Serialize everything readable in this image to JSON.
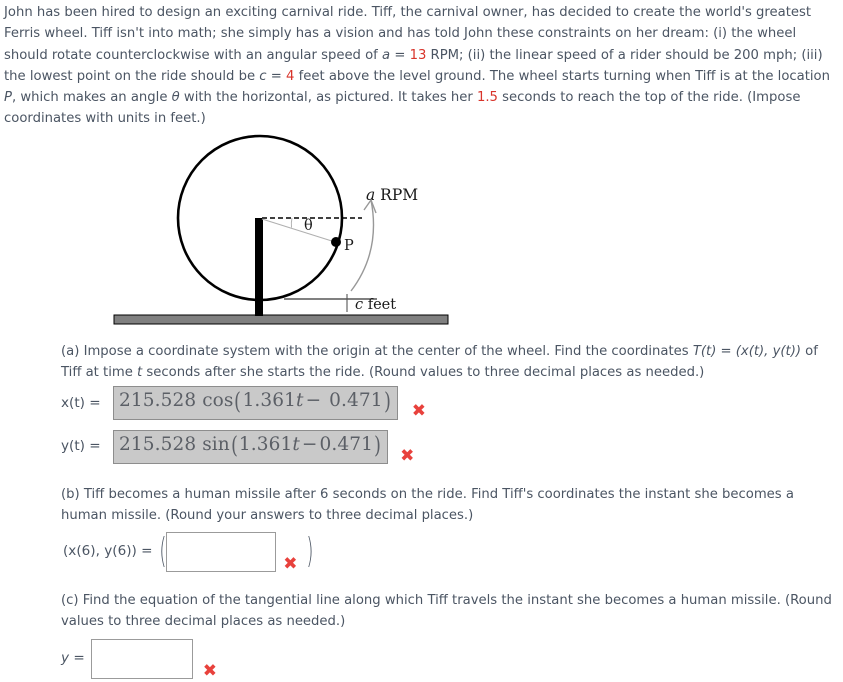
{
  "problem": {
    "segments": [
      {
        "t": "John has been hired to design an exciting carnival ride. Tiff, the carnival owner, has decided to create the world's greatest Ferris wheel. Tiff isn't into math; she simply has a vision and has told John these constraints on her dream: (i) the wheel should rotate counterclockwise with an angular speed of ",
        "style": "normal"
      },
      {
        "t": "a",
        "style": "italic"
      },
      {
        "t": " = ",
        "style": "normal"
      },
      {
        "t": "13",
        "style": "red"
      },
      {
        "t": " RPM; (ii) the linear speed of a rider should be 200 mph; (iii) the lowest point on the ride should be ",
        "style": "normal"
      },
      {
        "t": "c",
        "style": "italic"
      },
      {
        "t": " = ",
        "style": "normal"
      },
      {
        "t": "4",
        "style": "red"
      },
      {
        "t": " feet above the level ground. The wheel starts turning when Tiff is at the location ",
        "style": "normal"
      },
      {
        "t": "P",
        "style": "italic"
      },
      {
        "t": ", which makes an angle ",
        "style": "normal"
      },
      {
        "t": "θ",
        "style": "italic"
      },
      {
        "t": " with the horizontal, as pictured. It takes her ",
        "style": "normal"
      },
      {
        "t": "1.5",
        "style": "red"
      },
      {
        "t": " seconds to reach the top of the ride. (Impose coordinates with units in feet.)",
        "style": "normal"
      }
    ]
  },
  "figure": {
    "label_rpm": "a RPM",
    "label_rpm_italic": "a",
    "label_rpm_rest": " RPM",
    "label_theta": "θ",
    "label_p": "P",
    "label_c": "c",
    "label_c_rest": " feet",
    "colors": {
      "circle": "#000000",
      "pole": "#000000",
      "ground": "#808080",
      "ground_outline": "#000000",
      "arc": "#8a8a8a",
      "dashed": "#000000",
      "radius": "#a8a8a8"
    }
  },
  "part_a": {
    "prompt_1": "(a) Impose a coordinate system with the origin at the center of the wheel. Find the coordinates  ",
    "prompt_T": "T(t) = (x(t), y(t))",
    "prompt_2": " of Tiff at time ",
    "prompt_t": "t",
    "prompt_3": " seconds after she starts the ride. (Round values to three decimal places as needed.)",
    "x_label": "x(t)  =",
    "y_label": "y(t)  =",
    "x_answer": {
      "amplitude": "215.528",
      "func": "cos",
      "open": "(",
      "coefficient": "1.361",
      "variable": "t",
      "operator": "−",
      "phase": "0.471",
      "close": ")",
      "full": "215.528 cos(1.361t − 0.471)"
    },
    "y_answer": {
      "amplitude": "215.528",
      "func": "sin",
      "open": "(",
      "coefficient": "1.361",
      "variable": "t",
      "operator": "−",
      "phase": "0.471",
      "close": ")",
      "full": "215.528 sin(1.361t − 0.471)"
    },
    "x_status": "✖",
    "y_status": "✖"
  },
  "part_b": {
    "prompt": "(b) Tiff becomes a human missile after 6 seconds on the ride. Find Tiff's coordinates the instant she becomes a human missile. (Round your answers to three decimal places.)",
    "label": "(x(6), y(6))  =",
    "open_paren": "(",
    "close_paren": ")",
    "value": "",
    "status": "✖"
  },
  "part_c": {
    "prompt": "(c) Find the equation of the tangential line along which Tiff travels the instant she becomes a human missile. (Round values to three decimal places as needed.)",
    "label": "y =",
    "value": "",
    "status": "✖"
  }
}
